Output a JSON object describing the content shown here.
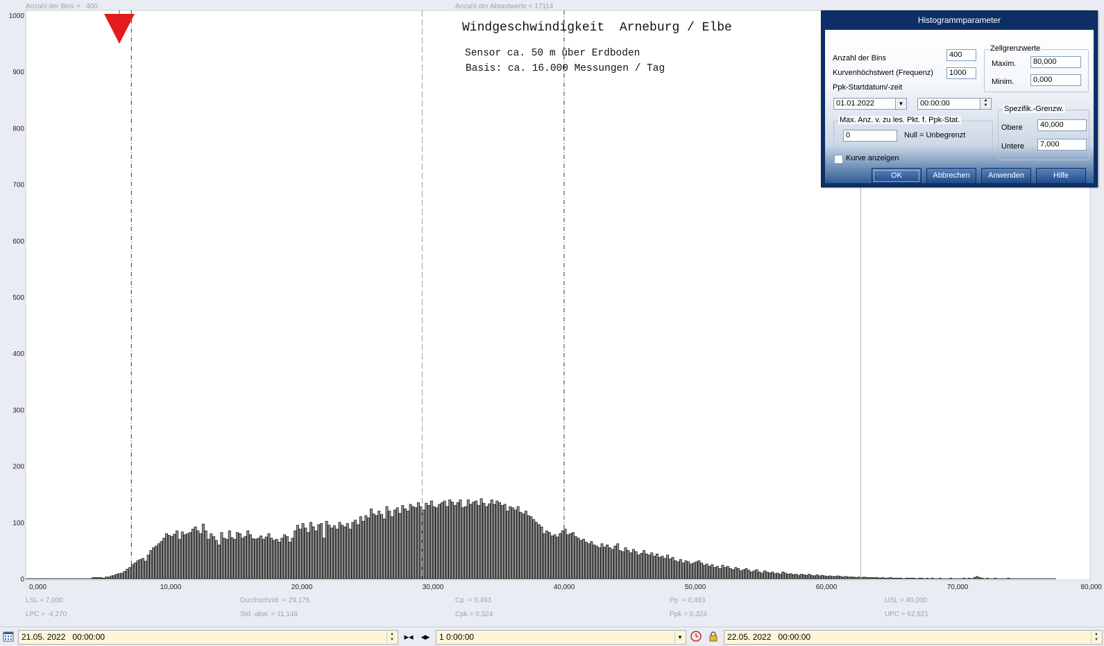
{
  "chart_data": {
    "type": "bar",
    "title": "Windgeschwindigkeit  Arneburg / Elbe",
    "subtitle_lines": [
      "Sensor ca. 50 m über Erdboden",
      "Basis: ca. 16.000 Messungen / Tag"
    ],
    "xlabel": "",
    "ylabel": "",
    "xlim": [
      0,
      80
    ],
    "ylim": [
      0,
      1000
    ],
    "y_ticks": [
      "0",
      "100",
      "200",
      "300",
      "400",
      "500",
      "600",
      "700",
      "800",
      "900",
      "1000"
    ],
    "x_ticks": [
      {
        "value": 0,
        "label": "0,000"
      },
      {
        "value": 10,
        "label": "10,000"
      },
      {
        "value": 20,
        "label": "20,000"
      },
      {
        "value": 30,
        "label": "30,000"
      },
      {
        "value": 40,
        "label": "40,000"
      },
      {
        "value": 50,
        "label": "50,000"
      },
      {
        "value": 60,
        "label": "60,000"
      },
      {
        "value": 70,
        "label": "70,000"
      },
      {
        "value": 80,
        "label": "80,000"
      }
    ],
    "bin_width": 0.2,
    "bins_start": 4.0,
    "values": [
      2,
      2,
      2,
      2,
      1,
      3,
      3,
      5,
      6,
      8,
      9,
      10,
      13,
      17,
      20,
      25,
      28,
      32,
      34,
      36,
      31,
      42,
      50,
      55,
      58,
      62,
      66,
      72,
      80,
      77,
      75,
      79,
      85,
      70,
      83,
      78,
      80,
      82,
      88,
      92,
      85,
      80,
      97,
      85,
      70,
      80,
      75,
      68,
      60,
      82,
      72,
      70,
      85,
      73,
      70,
      82,
      80,
      72,
      75,
      85,
      78,
      71,
      70,
      72,
      76,
      70,
      74,
      80,
      72,
      68,
      70,
      65,
      72,
      78,
      75,
      65,
      72,
      85,
      95,
      88,
      98,
      90,
      82,
      100,
      92,
      85,
      96,
      98,
      72,
      102,
      95,
      90,
      94,
      88,
      100,
      95,
      92,
      98,
      88,
      100,
      104,
      96,
      110,
      102,
      112,
      108,
      124,
      115,
      112,
      120,
      114,
      106,
      128,
      120,
      110,
      122,
      126,
      116,
      130,
      124,
      120,
      132,
      128,
      126,
      135,
      128,
      122,
      134,
      130,
      138,
      128,
      126,
      132,
      135,
      138,
      128,
      140,
      136,
      130,
      135,
      140,
      126,
      128,
      140,
      132,
      136,
      138,
      130,
      142,
      134,
      128,
      133,
      140,
      132,
      138,
      135,
      130,
      132,
      120,
      128,
      126,
      122,
      128,
      118,
      115,
      120,
      112,
      110,
      105,
      100,
      96,
      92,
      80,
      85,
      82,
      76,
      78,
      74,
      80,
      85,
      88,
      78,
      80,
      82,
      75,
      72,
      68,
      70,
      65,
      62,
      66,
      60,
      58,
      55,
      62,
      56,
      60,
      55,
      52,
      58,
      62,
      50,
      48,
      55,
      50,
      46,
      52,
      48,
      42,
      45,
      50,
      44,
      42,
      46,
      40,
      44,
      38,
      40,
      36,
      42,
      35,
      38,
      32,
      30,
      34,
      28,
      32,
      30,
      26,
      28,
      30,
      32,
      28,
      24,
      26,
      22,
      25,
      20,
      22,
      18,
      24,
      20,
      22,
      18,
      16,
      20,
      18,
      14,
      16,
      18,
      15,
      12,
      14,
      16,
      12,
      10,
      14,
      12,
      10,
      12,
      9,
      10,
      8,
      12,
      10,
      8,
      9,
      7,
      8,
      6,
      8,
      7,
      6,
      8,
      6,
      5,
      7,
      5,
      6,
      5,
      4,
      5,
      4,
      4,
      5,
      4,
      3,
      4,
      3,
      3,
      3,
      2,
      3,
      2,
      3,
      2,
      2,
      2,
      2,
      2,
      1,
      2,
      1,
      1,
      2,
      1,
      1,
      1,
      1,
      0,
      1,
      1,
      1,
      1,
      0,
      1,
      1,
      0,
      1,
      0,
      1,
      0,
      0,
      1,
      0,
      0,
      0,
      1,
      0,
      0,
      0,
      0,
      1,
      0,
      1,
      0,
      2,
      4,
      2,
      1,
      0,
      1,
      0,
      0,
      1,
      0,
      0,
      0,
      0,
      1,
      0,
      0,
      0,
      0,
      0,
      0,
      0,
      0,
      0,
      0,
      0,
      0,
      0,
      0,
      0,
      0,
      0,
      0,
      0,
      0,
      0,
      0,
      0,
      0,
      0,
      0,
      0,
      0,
      0,
      0,
      0,
      0,
      0,
      0,
      0,
      0,
      0,
      0,
      0,
      0,
      0,
      0,
      0,
      0,
      0,
      0,
      0,
      0,
      0,
      0,
      0,
      0,
      0,
      0,
      0
    ],
    "reference_lines": [
      {
        "name": "lsl",
        "value": 7.0,
        "style": "dash-dot"
      },
      {
        "name": "mean",
        "value": 29.175,
        "style": "dashed"
      },
      {
        "name": "usl",
        "value": 40.0,
        "style": "dash-dot"
      },
      {
        "name": "upc",
        "value": 62.621,
        "style": "solid"
      }
    ],
    "marker": {
      "value": 7.0,
      "color": "#e02020"
    },
    "grid": false,
    "bar_color": "#8c8c8c",
    "bar_edge_color": "#111111"
  },
  "top_info": {
    "bins": "Anzahl der Bins =   400",
    "samples": "Anzahl der Abtastwerte = 17114"
  },
  "stats": {
    "lsl": "LSL = 7,000",
    "lpc": "LPC = -4,270",
    "mean": "Durchschnitt  = 29,175",
    "std": "Std.-abw. = 11,148",
    "cp": "Cp  = 0,493",
    "cpk": "Cpk = 0,324",
    "pp": "Pp  = 0,493",
    "ppk": "Ppk = 0,324",
    "usl": "USL = 40,000",
    "upc": "UPC = 62,621"
  },
  "dialog": {
    "title": "Histogrammparameter",
    "bins_label": "Anzahl der Bins",
    "bins_value": "400",
    "max_freq_label": "Kurvenhöchstwert (Frequenz)",
    "max_freq_value": "1000",
    "ppk_start_label": "Ppk-Startdatum/-zeit",
    "ppk_start_date": "01.01.2022",
    "ppk_start_time": "00:00:00",
    "cell_limits_title": "Zellgrenzwerte",
    "max_label": "Maxim.",
    "max_value": "80,000",
    "min_label": "Minim.",
    "min_value": "0,000",
    "spec_title": "Spezifik.-Grenzw.",
    "upper_label": "Obere",
    "upper_value": "40,000",
    "lower_label": "Untere",
    "lower_value": "7,000",
    "maxpts_title": "Max. Anz. v. zu les. Pkt. f. Ppk-Stat.",
    "maxpts_value": "0",
    "maxpts_hint": "Null = Unbegrenzt",
    "show_curve_label": "Kurve anzeigen",
    "show_curve_checked": false,
    "ok": "OK",
    "cancel": "Abbrechen",
    "apply": "Anwenden",
    "help": "Hilfe"
  },
  "bottom": {
    "start": "21.05. 2022   00:00:00",
    "duration": "1 0:00:00",
    "end": "22.05. 2022   00:00:00",
    "field_color": "#fff6d6"
  }
}
